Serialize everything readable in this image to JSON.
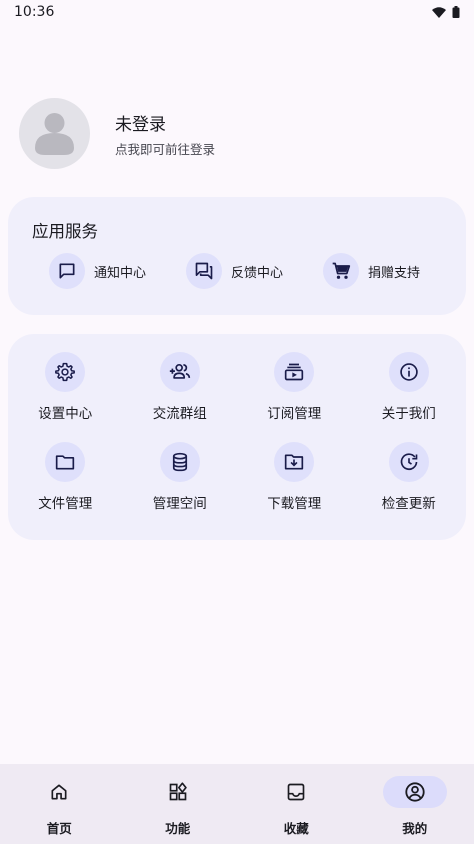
{
  "status_bar": {
    "time": "10:36"
  },
  "profile": {
    "name": "未登录",
    "hint": "点我即可前往登录"
  },
  "services": {
    "title": "应用服务",
    "items": [
      {
        "label": "通知中心",
        "icon": "message-icon"
      },
      {
        "label": "反馈中心",
        "icon": "forum-icon"
      },
      {
        "label": "捐赠支持",
        "icon": "cart-icon"
      }
    ]
  },
  "grid": {
    "items": [
      {
        "label": "设置中心",
        "icon": "gear-icon"
      },
      {
        "label": "交流群组",
        "icon": "group-add-icon"
      },
      {
        "label": "订阅管理",
        "icon": "subscriptions-icon"
      },
      {
        "label": "关于我们",
        "icon": "info-icon"
      },
      {
        "label": "文件管理",
        "icon": "folder-icon"
      },
      {
        "label": "管理空间",
        "icon": "database-icon"
      },
      {
        "label": "下载管理",
        "icon": "folder-download-icon"
      },
      {
        "label": "检查更新",
        "icon": "update-icon"
      }
    ]
  },
  "bottom_nav": {
    "items": [
      {
        "label": "首页",
        "icon": "home-icon"
      },
      {
        "label": "功能",
        "icon": "widgets-icon"
      },
      {
        "label": "收藏",
        "icon": "inbox-icon"
      },
      {
        "label": "我的",
        "icon": "account-circle-icon",
        "active": true
      }
    ]
  },
  "colors": {
    "accent": "#dfe0fb",
    "card": "#f0effb",
    "nav_active": "#dcdcfb",
    "icon": "#1a1c4a"
  }
}
